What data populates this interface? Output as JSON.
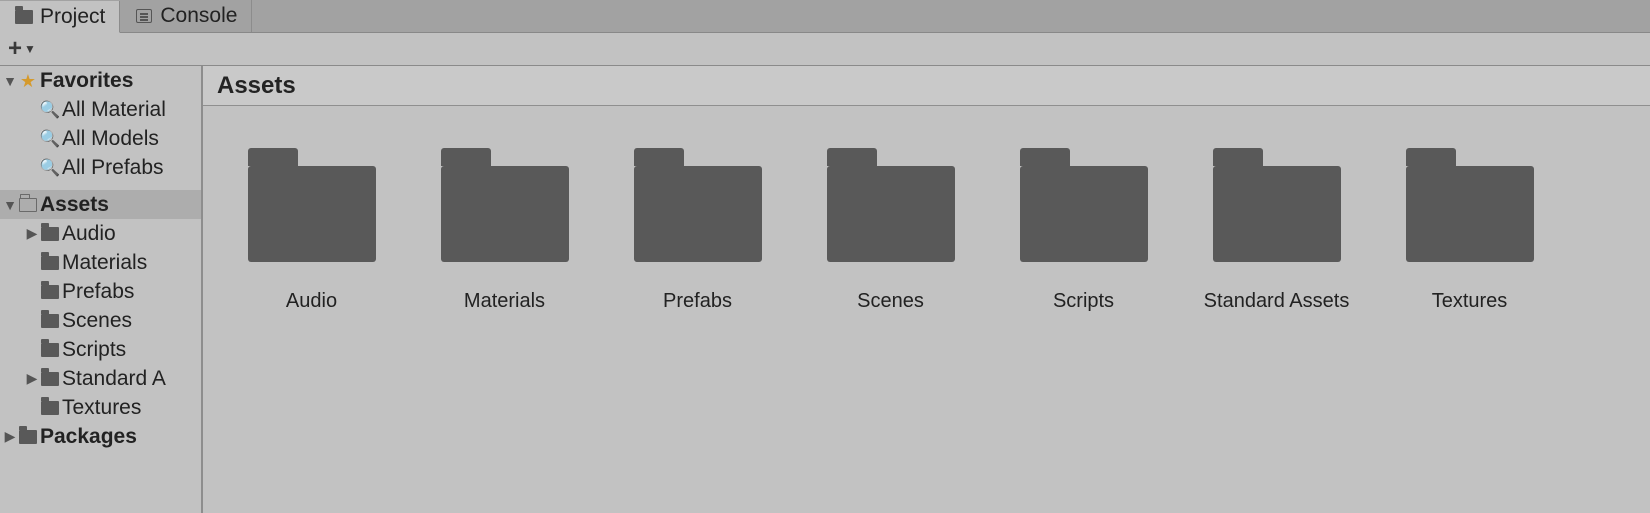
{
  "tabs": [
    {
      "label": "Project",
      "active": true
    },
    {
      "label": "Console",
      "active": false
    }
  ],
  "breadcrumb": "Assets",
  "sidebar": {
    "favorites": {
      "label": "Favorites",
      "items": [
        {
          "label": "All Material"
        },
        {
          "label": "All Models"
        },
        {
          "label": "All Prefabs"
        }
      ]
    },
    "assets": {
      "label": "Assets",
      "children": [
        {
          "label": "Audio",
          "expandable": true
        },
        {
          "label": "Materials",
          "expandable": false
        },
        {
          "label": "Prefabs",
          "expandable": false
        },
        {
          "label": "Scenes",
          "expandable": false
        },
        {
          "label": "Scripts",
          "expandable": false
        },
        {
          "label": "Standard A",
          "expandable": true
        },
        {
          "label": "Textures",
          "expandable": false
        }
      ]
    },
    "packages": {
      "label": "Packages"
    }
  },
  "grid": [
    {
      "label": "Audio"
    },
    {
      "label": "Materials"
    },
    {
      "label": "Prefabs"
    },
    {
      "label": "Scenes"
    },
    {
      "label": "Scripts"
    },
    {
      "label": "Standard Assets"
    },
    {
      "label": "Textures"
    }
  ]
}
